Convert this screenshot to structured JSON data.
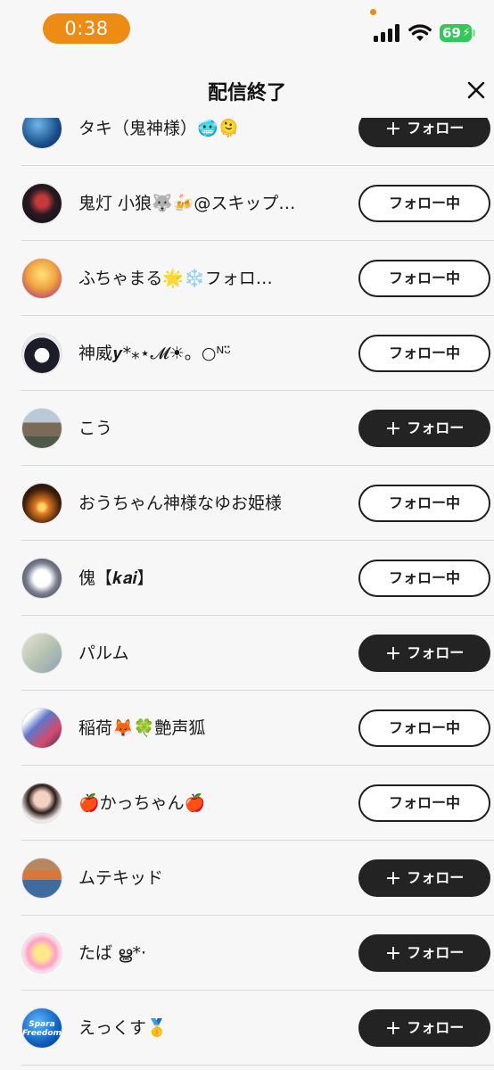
{
  "status_bar": {
    "time": "0:38",
    "battery": "69"
  },
  "header": {
    "title": "配信終了"
  },
  "buttons": {
    "follow_label": "フォロー",
    "following_label": "フォロー中"
  },
  "colors": {
    "accent": "#ec8c14",
    "follow_bg": "#232323",
    "battery": "#34c759"
  },
  "users": [
    {
      "name": "タキ（鬼神様）🥶🫠",
      "state": "follow"
    },
    {
      "name": "鬼灯 小狼🐺🍻@スキップ…",
      "state": "following"
    },
    {
      "name": "ふちゃまる🌟❄️フォロ…",
      "state": "following"
    },
    {
      "name": "神威𝒚*⁎⋆𝓜☀︎。○ᴺᵕ̈",
      "state": "following"
    },
    {
      "name": "こう",
      "state": "follow"
    },
    {
      "name": "おうちゃん神様なゆお姫様",
      "state": "following"
    },
    {
      "name": "傀【𝒌𝒂𝒊】",
      "state": "following"
    },
    {
      "name": "パルム",
      "state": "follow"
    },
    {
      "name": "稲荷🦊🍀艶声狐",
      "state": "following"
    },
    {
      "name": "🍎かっちゃん🍎",
      "state": "following"
    },
    {
      "name": "ムテキッド",
      "state": "follow"
    },
    {
      "name": "たば ൠ*·",
      "state": "follow"
    },
    {
      "name": "えっくす🥇",
      "state": "follow"
    }
  ],
  "avatar_13_logo": "Spara Freedom"
}
